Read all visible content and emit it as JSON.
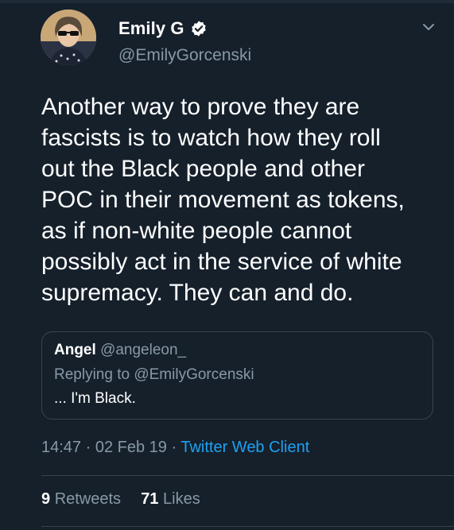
{
  "tweet": {
    "author": {
      "display_name": "Emily G",
      "handle": "@EmilyGorcenski",
      "verified": true
    },
    "text": "Another way to prove they are\nfascists is to watch how they roll\nout the Black people and other\nPOC in their movement as tokens,\nas if non-white people cannot\npossibly act in the service of white\nsupremacy. They can and do.",
    "quoted": {
      "name": "Angel",
      "handle": "@angeleon_",
      "replying_prefix": "Replying to ",
      "replying_to": "@EmilyGorcenski",
      "text": "... I'm Black."
    },
    "meta": {
      "time": "14:47",
      "sep1": " · ",
      "date": "02 Feb 19",
      "sep2": " · ",
      "client": "Twitter Web Client"
    },
    "stats": {
      "retweets_count": "9",
      "retweets_label": "Retweets",
      "likes_count": "71",
      "likes_label": "Likes"
    }
  },
  "icons": {
    "verified": "verified-badge-icon",
    "caret": "chevron-down-icon"
  },
  "colors": {
    "background": "#15202b",
    "text_primary": "#ffffff",
    "text_secondary": "#8899a6",
    "accent": "#1da1f2",
    "border": "#38444d"
  }
}
